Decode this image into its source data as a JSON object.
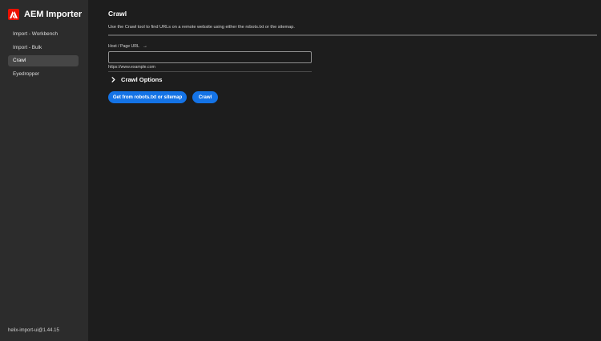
{
  "app": {
    "title": "AEM Importer",
    "logo_icon": "adobe-logo-icon",
    "accent_color": "#eb1000",
    "version": "helix-import-ui@1.44.15"
  },
  "sidebar": {
    "items": [
      {
        "label": "Import - Workbench",
        "active": false
      },
      {
        "label": "Import - Bulk",
        "active": false
      },
      {
        "label": "Crawl",
        "active": true
      },
      {
        "label": "Eyedropper",
        "active": false
      }
    ]
  },
  "main": {
    "title": "Crawl",
    "description": "Use the Crawl tool to find URLs on a remote website using either the robots.txt or the sitemap.",
    "url_field": {
      "label": "Host / Page URL",
      "label_icon": "arrow-right-icon",
      "value": "",
      "help_text": "https://www.example.com"
    },
    "options": {
      "label": "Crawl Options",
      "icon": "chevron-right-icon",
      "expanded": false
    },
    "buttons": {
      "robots_label": "Get from robots.txt or sitemap",
      "crawl_label": "Crawl",
      "color": "#1473e6"
    }
  }
}
